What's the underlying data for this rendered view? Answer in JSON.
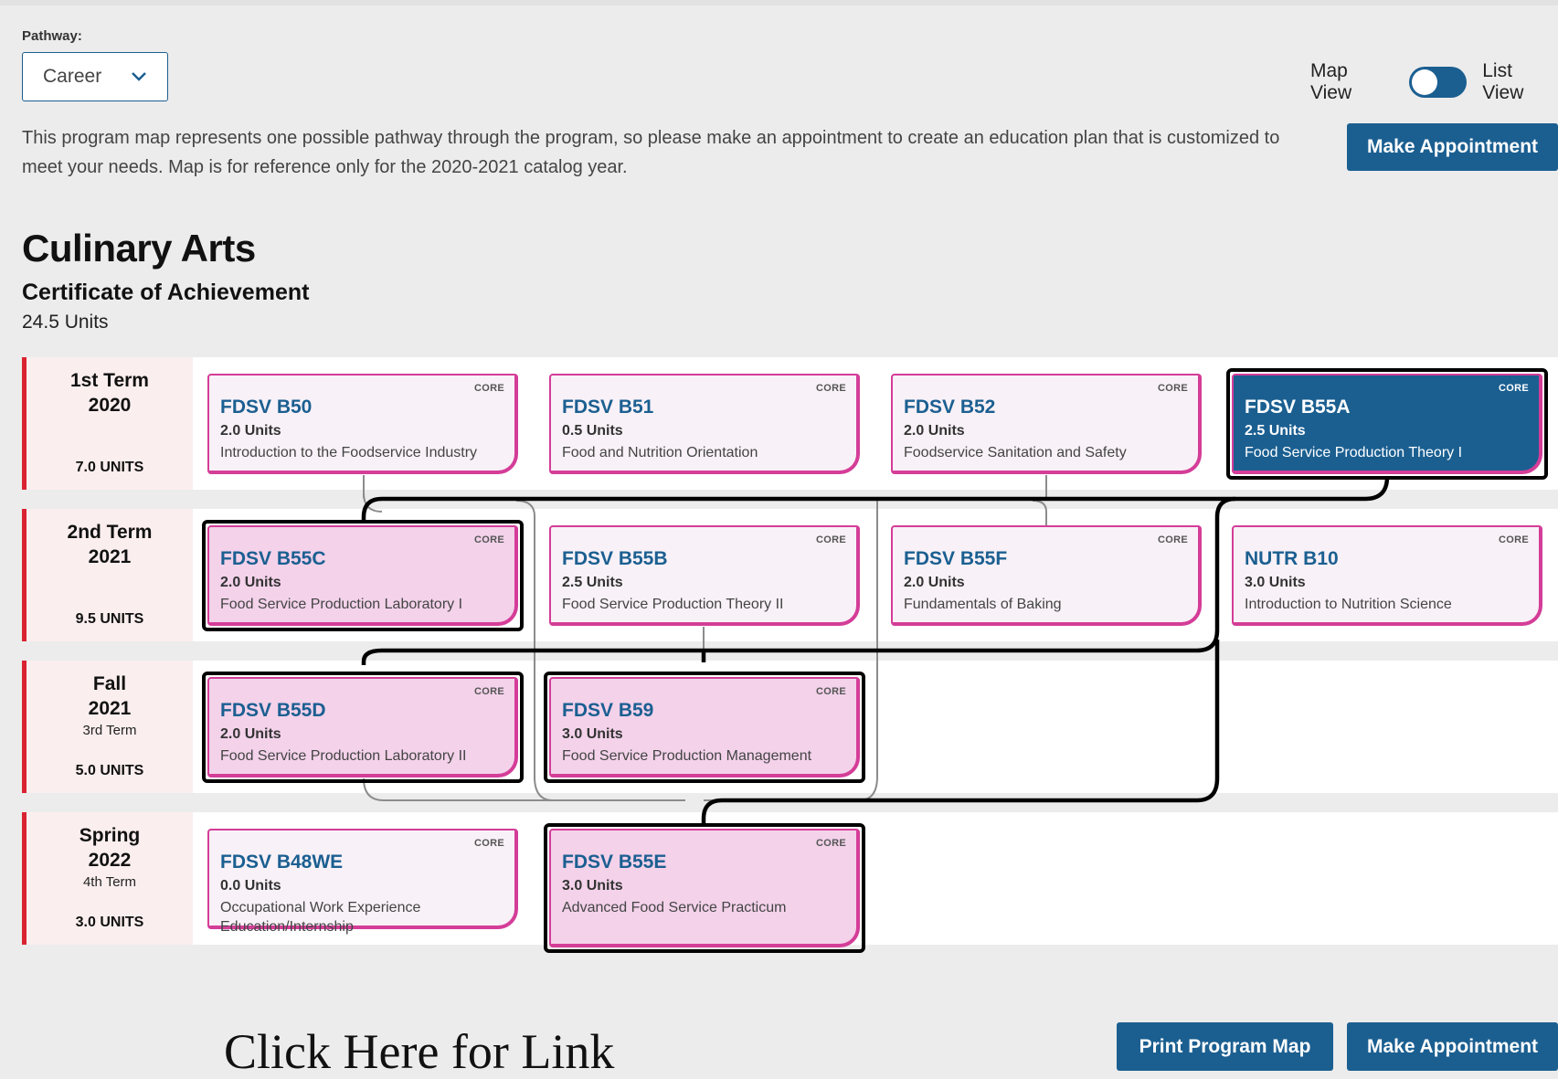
{
  "pathway": {
    "label": "Pathway:",
    "value": "Career"
  },
  "view_toggle": {
    "map_label": "Map View",
    "list_label": "List View",
    "active": "Map View"
  },
  "description": "This program map represents one possible pathway through the program, so please make an appointment to create an education plan that is customized to meet your needs. Map is for reference only for the 2020-2021 catalog year.",
  "buttons": {
    "make_appointment": "Make Appointment",
    "print_map": "Print Program Map"
  },
  "program": {
    "name": "Culinary Arts",
    "award": "Certificate of Achievement",
    "units": "24.5 Units"
  },
  "terms": [
    {
      "name": "1st Term",
      "year": "2020",
      "sub": "",
      "units": "7.0 UNITS"
    },
    {
      "name": "2nd Term",
      "year": "2021",
      "sub": "",
      "units": "9.5 UNITS"
    },
    {
      "name": "Fall",
      "year": "2021",
      "sub": "3rd Term",
      "units": "5.0 UNITS"
    },
    {
      "name": "Spring",
      "year": "2022",
      "sub": "4th Term",
      "units": "3.0 UNITS"
    }
  ],
  "courses": [
    {
      "code": "FDSV B50",
      "units": "2.0 Units",
      "title": "Introduction to the Foodservice Industry",
      "tag": "CORE"
    },
    {
      "code": "FDSV B51",
      "units": "0.5 Units",
      "title": "Food and Nutrition Orientation",
      "tag": "CORE"
    },
    {
      "code": "FDSV B52",
      "units": "2.0 Units",
      "title": "Foodservice Sanitation and Safety",
      "tag": "CORE"
    },
    {
      "code": "FDSV B55A",
      "units": "2.5 Units",
      "title": "Food Service Production Theory I",
      "tag": "CORE"
    },
    {
      "code": "FDSV B55C",
      "units": "2.0 Units",
      "title": "Food Service Production Laboratory I",
      "tag": "CORE"
    },
    {
      "code": "FDSV B55B",
      "units": "2.5 Units",
      "title": "Food Service Production Theory II",
      "tag": "CORE"
    },
    {
      "code": "FDSV B55F",
      "units": "2.0 Units",
      "title": "Fundamentals of Baking",
      "tag": "CORE"
    },
    {
      "code": "NUTR B10",
      "units": "3.0 Units",
      "title": "Introduction to Nutrition Science",
      "tag": "CORE"
    },
    {
      "code": "FDSV B55D",
      "units": "2.0 Units",
      "title": "Food Service Production Laboratory II",
      "tag": "CORE"
    },
    {
      "code": "FDSV B59",
      "units": "3.0 Units",
      "title": "Food Service Production Management",
      "tag": "CORE"
    },
    {
      "code": "FDSV B48WE",
      "units": "0.0 Units",
      "title": "Occupational Work Experience Education/Internship",
      "tag": "CORE"
    },
    {
      "code": "FDSV B55E",
      "units": "3.0 Units",
      "title": "Advanced Food Service Practicum",
      "tag": "CORE"
    }
  ],
  "link_text": "Click Here for Link"
}
